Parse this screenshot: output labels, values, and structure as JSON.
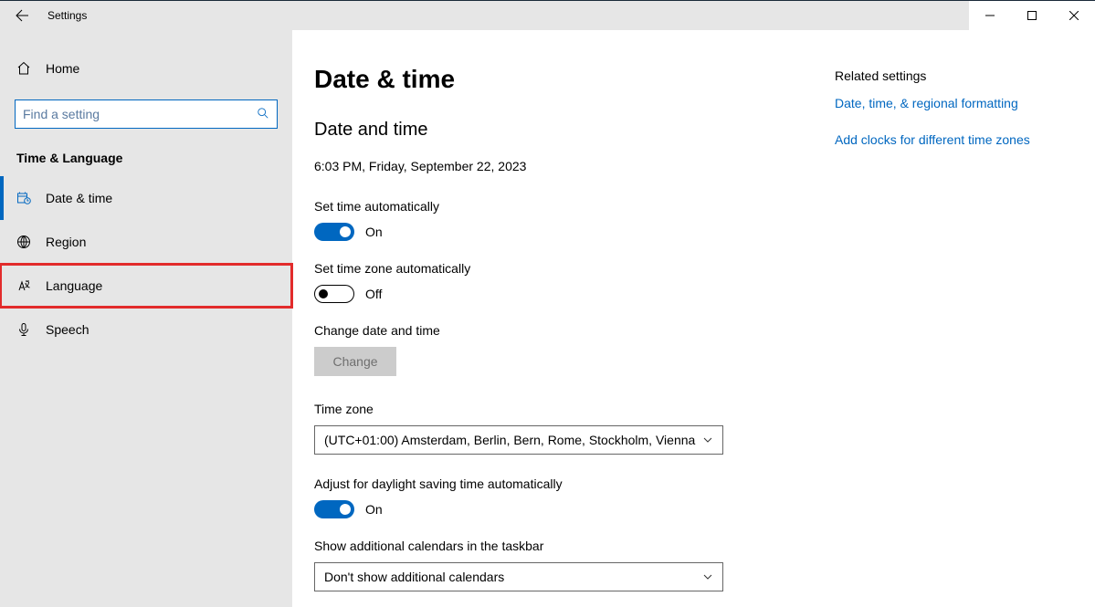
{
  "titlebar": {
    "title": "Settings",
    "back_icon": "arrow-left"
  },
  "sidebar": {
    "home_label": "Home",
    "search": {
      "placeholder": "Find a setting"
    },
    "section_header": "Time & Language",
    "items": [
      {
        "icon": "date-time",
        "label": "Date & time",
        "active": true,
        "highlighted": false
      },
      {
        "icon": "globe",
        "label": "Region",
        "active": false,
        "highlighted": false
      },
      {
        "icon": "language",
        "label": "Language",
        "active": false,
        "highlighted": true
      },
      {
        "icon": "mic",
        "label": "Speech",
        "active": false,
        "highlighted": false
      }
    ]
  },
  "main": {
    "page_title": "Date & time",
    "subheading": "Date and time",
    "current_time": "6:03 PM, Friday, September 22, 2023",
    "set_time_auto": {
      "label": "Set time automatically",
      "state": "On",
      "on": true
    },
    "set_tz_auto": {
      "label": "Set time zone automatically",
      "state": "Off",
      "on": false
    },
    "change_dt": {
      "label": "Change date and time",
      "button": "Change"
    },
    "timezone": {
      "label": "Time zone",
      "value": "(UTC+01:00) Amsterdam, Berlin, Bern, Rome, Stockholm, Vienna"
    },
    "dst": {
      "label": "Adjust for daylight saving time automatically",
      "state": "On",
      "on": true
    },
    "add_cal": {
      "label": "Show additional calendars in the taskbar",
      "value": "Don't show additional calendars"
    }
  },
  "related": {
    "heading": "Related settings",
    "links": [
      "Date, time, & regional formatting",
      "Add clocks for different time zones"
    ]
  }
}
